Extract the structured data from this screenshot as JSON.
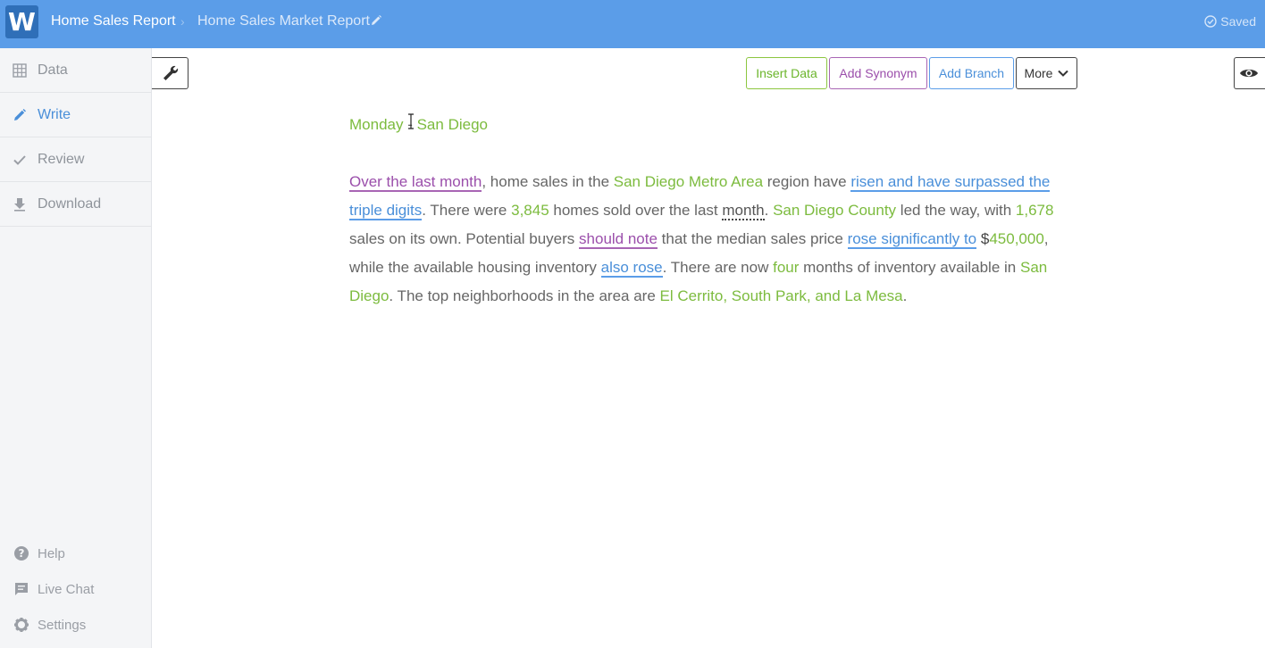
{
  "header": {
    "logo_letter": "W",
    "breadcrumb_project": "Home Sales Report",
    "breadcrumb_separator": "›",
    "breadcrumb_document": "Home Sales Market Report",
    "status": "Saved",
    "bg_color": "#5b9de8"
  },
  "sidebar": {
    "items": [
      {
        "label": "Data",
        "icon": "grid-icon"
      },
      {
        "label": "Write",
        "icon": "pencil-icon"
      },
      {
        "label": "Review",
        "icon": "check-icon"
      },
      {
        "label": "Download",
        "icon": "download-icon"
      }
    ],
    "active": "Write",
    "bottom_items": [
      {
        "label": "Help",
        "icon": "help-icon"
      },
      {
        "label": "Live Chat",
        "icon": "chat-icon"
      },
      {
        "label": "Settings",
        "icon": "gear-icon"
      }
    ]
  },
  "toolbar": {
    "insert_data": "Insert Data",
    "add_synonym": "Add Synonym",
    "add_branch": "Add Branch",
    "more": "More"
  },
  "document": {
    "title_day": "Monday",
    "title_sep": " - ",
    "title_city": "San Diego",
    "segments": {
      "s1": "Over the last month",
      "s2": ", home sales in the ",
      "s3": "San Diego Metro Area",
      "s4": " region have ",
      "s5": "risen and have surpassed the triple digits",
      "s6": ". There were ",
      "s7": "3,845",
      "s8": " homes sold over the last ",
      "s9": "month",
      "s10": ". ",
      "s11": "San Diego County",
      "s12": " led the way, with ",
      "s13": "1,678",
      "s14": " sales on its own. Potential buyers ",
      "s15": "should note",
      "s16": " that the median sales price ",
      "s17": "rose significantly to",
      "s18": " $",
      "s19": "450,000",
      "s20": ", while the available housing inventory ",
      "s21": "also rose",
      "s22": ". There are now ",
      "s23": "four",
      "s24": " months of inventory available in ",
      "s25": "San Diego",
      "s26": ". The top neighborhoods in the area are ",
      "s27": "El Cerrito, South Park, and La Mesa",
      "s28": "."
    }
  },
  "colors": {
    "data_green": "#7cbb3e",
    "synonym_purple": "#9b4fab",
    "branch_blue": "#4a8fd9"
  }
}
